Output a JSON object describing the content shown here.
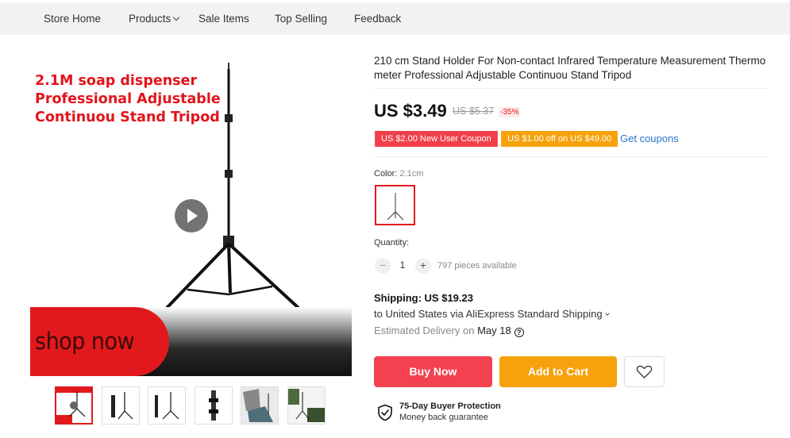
{
  "nav": {
    "items": [
      "Store Home",
      "Products",
      "Sale Items",
      "Top Selling",
      "Feedback"
    ]
  },
  "gallery": {
    "promo_lines": [
      "2.1M soap dispenser",
      "Professional Adjustable",
      "Continuou Stand Tripod"
    ],
    "banner_text": "shop now",
    "thumbnail_count": 6
  },
  "product": {
    "title_lines": [
      "210 cm Stand Holder For Non-contact Infrared Temperature Measurement Thermo",
      "meter Professional Adjustable Continuou Stand Tripod"
    ],
    "price": "US $3.49",
    "original_price": "US $5.37",
    "discount": "-35%",
    "coupons": [
      "US $2.00 New User Coupon",
      "US $1.00 off on US $49.00"
    ],
    "get_coupons": "Get coupons",
    "color_label": "Color:",
    "color_value": "2.1cm",
    "quantity_label": "Quantity:",
    "quantity": "1",
    "minus": "−",
    "plus": "+",
    "available": "797 pieces available",
    "shipping_title": "Shipping: US $19.23",
    "shipping_detail": "to United States via AliExpress Standard Shipping",
    "delivery_prefix": "Estimated Delivery on",
    "delivery_date": "May 18",
    "help_glyph": "?",
    "buy_now": "Buy Now",
    "add_to_cart": "Add to Cart",
    "protection_title": "75-Day Buyer Protection",
    "protection_sub": "Money back guarantee"
  },
  "colors": {
    "accent_red": "#f4414f",
    "accent_orange": "#f7a10d",
    "link_blue": "#2a77c9"
  }
}
